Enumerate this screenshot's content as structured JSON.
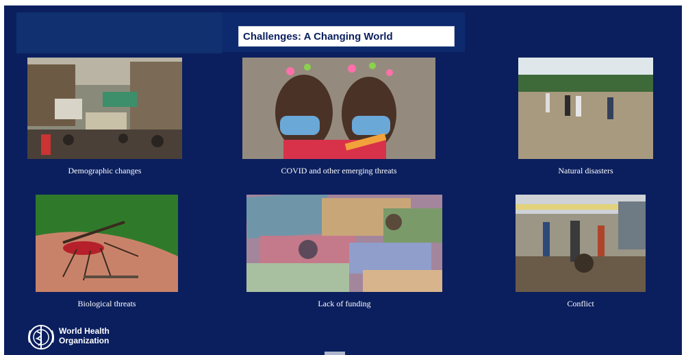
{
  "slide": {
    "title": "Challenges: A Changing World",
    "items": [
      {
        "caption": "Demographic changes",
        "image": "crowded-street-photo"
      },
      {
        "caption": "COVID and other emerging threats",
        "image": "masked-children-photo"
      },
      {
        "caption": "Natural disasters",
        "image": "flood-photo"
      },
      {
        "caption": "Biological threats",
        "image": "mosquito-photo"
      },
      {
        "caption": "Lack of funding",
        "image": "banknotes-photo"
      },
      {
        "caption": "Conflict",
        "image": "conflict-street-photo"
      }
    ]
  },
  "footer": {
    "logo_line1": "World Health",
    "logo_line2": "Organization",
    "logo_icon": "who-emblem-icon"
  },
  "colors": {
    "slide_background": "#0b1f5e",
    "title_background": "#ffffff",
    "caption_text": "#ffffff"
  }
}
